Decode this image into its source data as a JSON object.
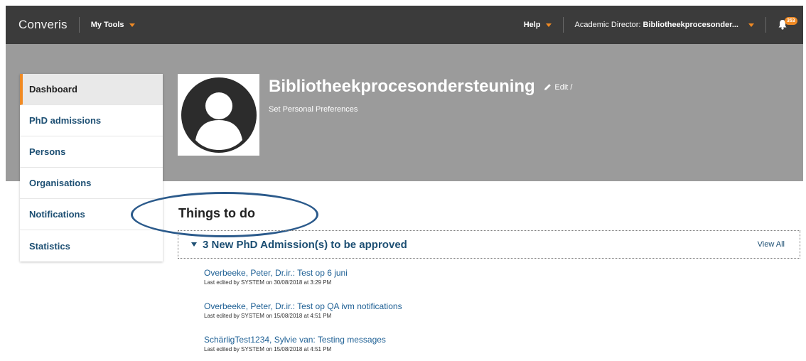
{
  "header": {
    "brand": "Converis",
    "my_tools": "My Tools",
    "help": "Help",
    "role_prefix": "Academic Director:",
    "role_name": "Bibliotheekprocesonder...",
    "notification_count": "353"
  },
  "sidebar": {
    "items": [
      {
        "label": "Dashboard"
      },
      {
        "label": "PhD admissions"
      },
      {
        "label": "Persons"
      },
      {
        "label": "Organisations"
      },
      {
        "label": "Notifications"
      },
      {
        "label": "Statistics"
      }
    ]
  },
  "profile": {
    "name": "Bibliotheekprocesondersteuning",
    "edit": "Edit /",
    "preferences": "Set Personal Preferences"
  },
  "todo": {
    "title": "Things to do",
    "section_title": "3 New PhD Admission(s) to be approved",
    "view_all": "View All",
    "items": [
      {
        "title": "Overbeeke, Peter, Dr.ir.: Test op 6 juni",
        "meta": "Last edited by SYSTEM on 30/08/2018 at 3:29 PM"
      },
      {
        "title": "Overbeeke, Peter, Dr.ir.: Test op QA ivm notifications",
        "meta": "Last edited by SYSTEM on 15/08/2018 at 4:51 PM"
      },
      {
        "title": "SchärligTest1234, Sylvie van: Testing messages",
        "meta": "Last edited by SYSTEM on 15/08/2018 at 4:51 PM"
      }
    ]
  },
  "colors": {
    "topbar": "#3b3b3b",
    "hero": "#9b9b9b",
    "accent": "#f08a24",
    "link": "#1d4f73",
    "annotation_ellipse": "#2b5a8b"
  }
}
